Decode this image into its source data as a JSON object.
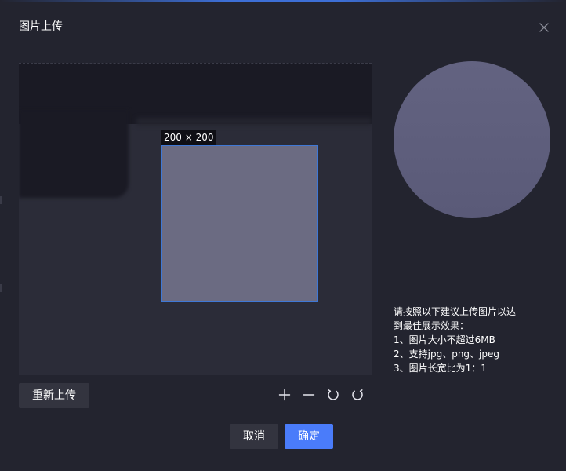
{
  "dialog": {
    "title": "图片上传",
    "close_icon": "close-icon"
  },
  "cropper": {
    "size_label": "200 × 200"
  },
  "tips": {
    "line1": "请按照以下建议上传图片以达",
    "line2": "到最佳展示效果：",
    "line3": "1、图片大小不超过6MB",
    "line4": "2、支持jpg、png、jpeg",
    "line5": "3、图片长宽比为1：1"
  },
  "toolbar": {
    "reupload_label": "重新上传",
    "tools": [
      "zoom-in-icon",
      "zoom-out-icon",
      "rotate-left-icon",
      "rotate-right-icon"
    ]
  },
  "footer": {
    "cancel_label": "取消",
    "confirm_label": "确定"
  },
  "colors": {
    "primary": "#4a7cfa",
    "dialog_bg": "#23242f",
    "crop_border": "#3f78d6",
    "preview": "#5f5f7d"
  }
}
